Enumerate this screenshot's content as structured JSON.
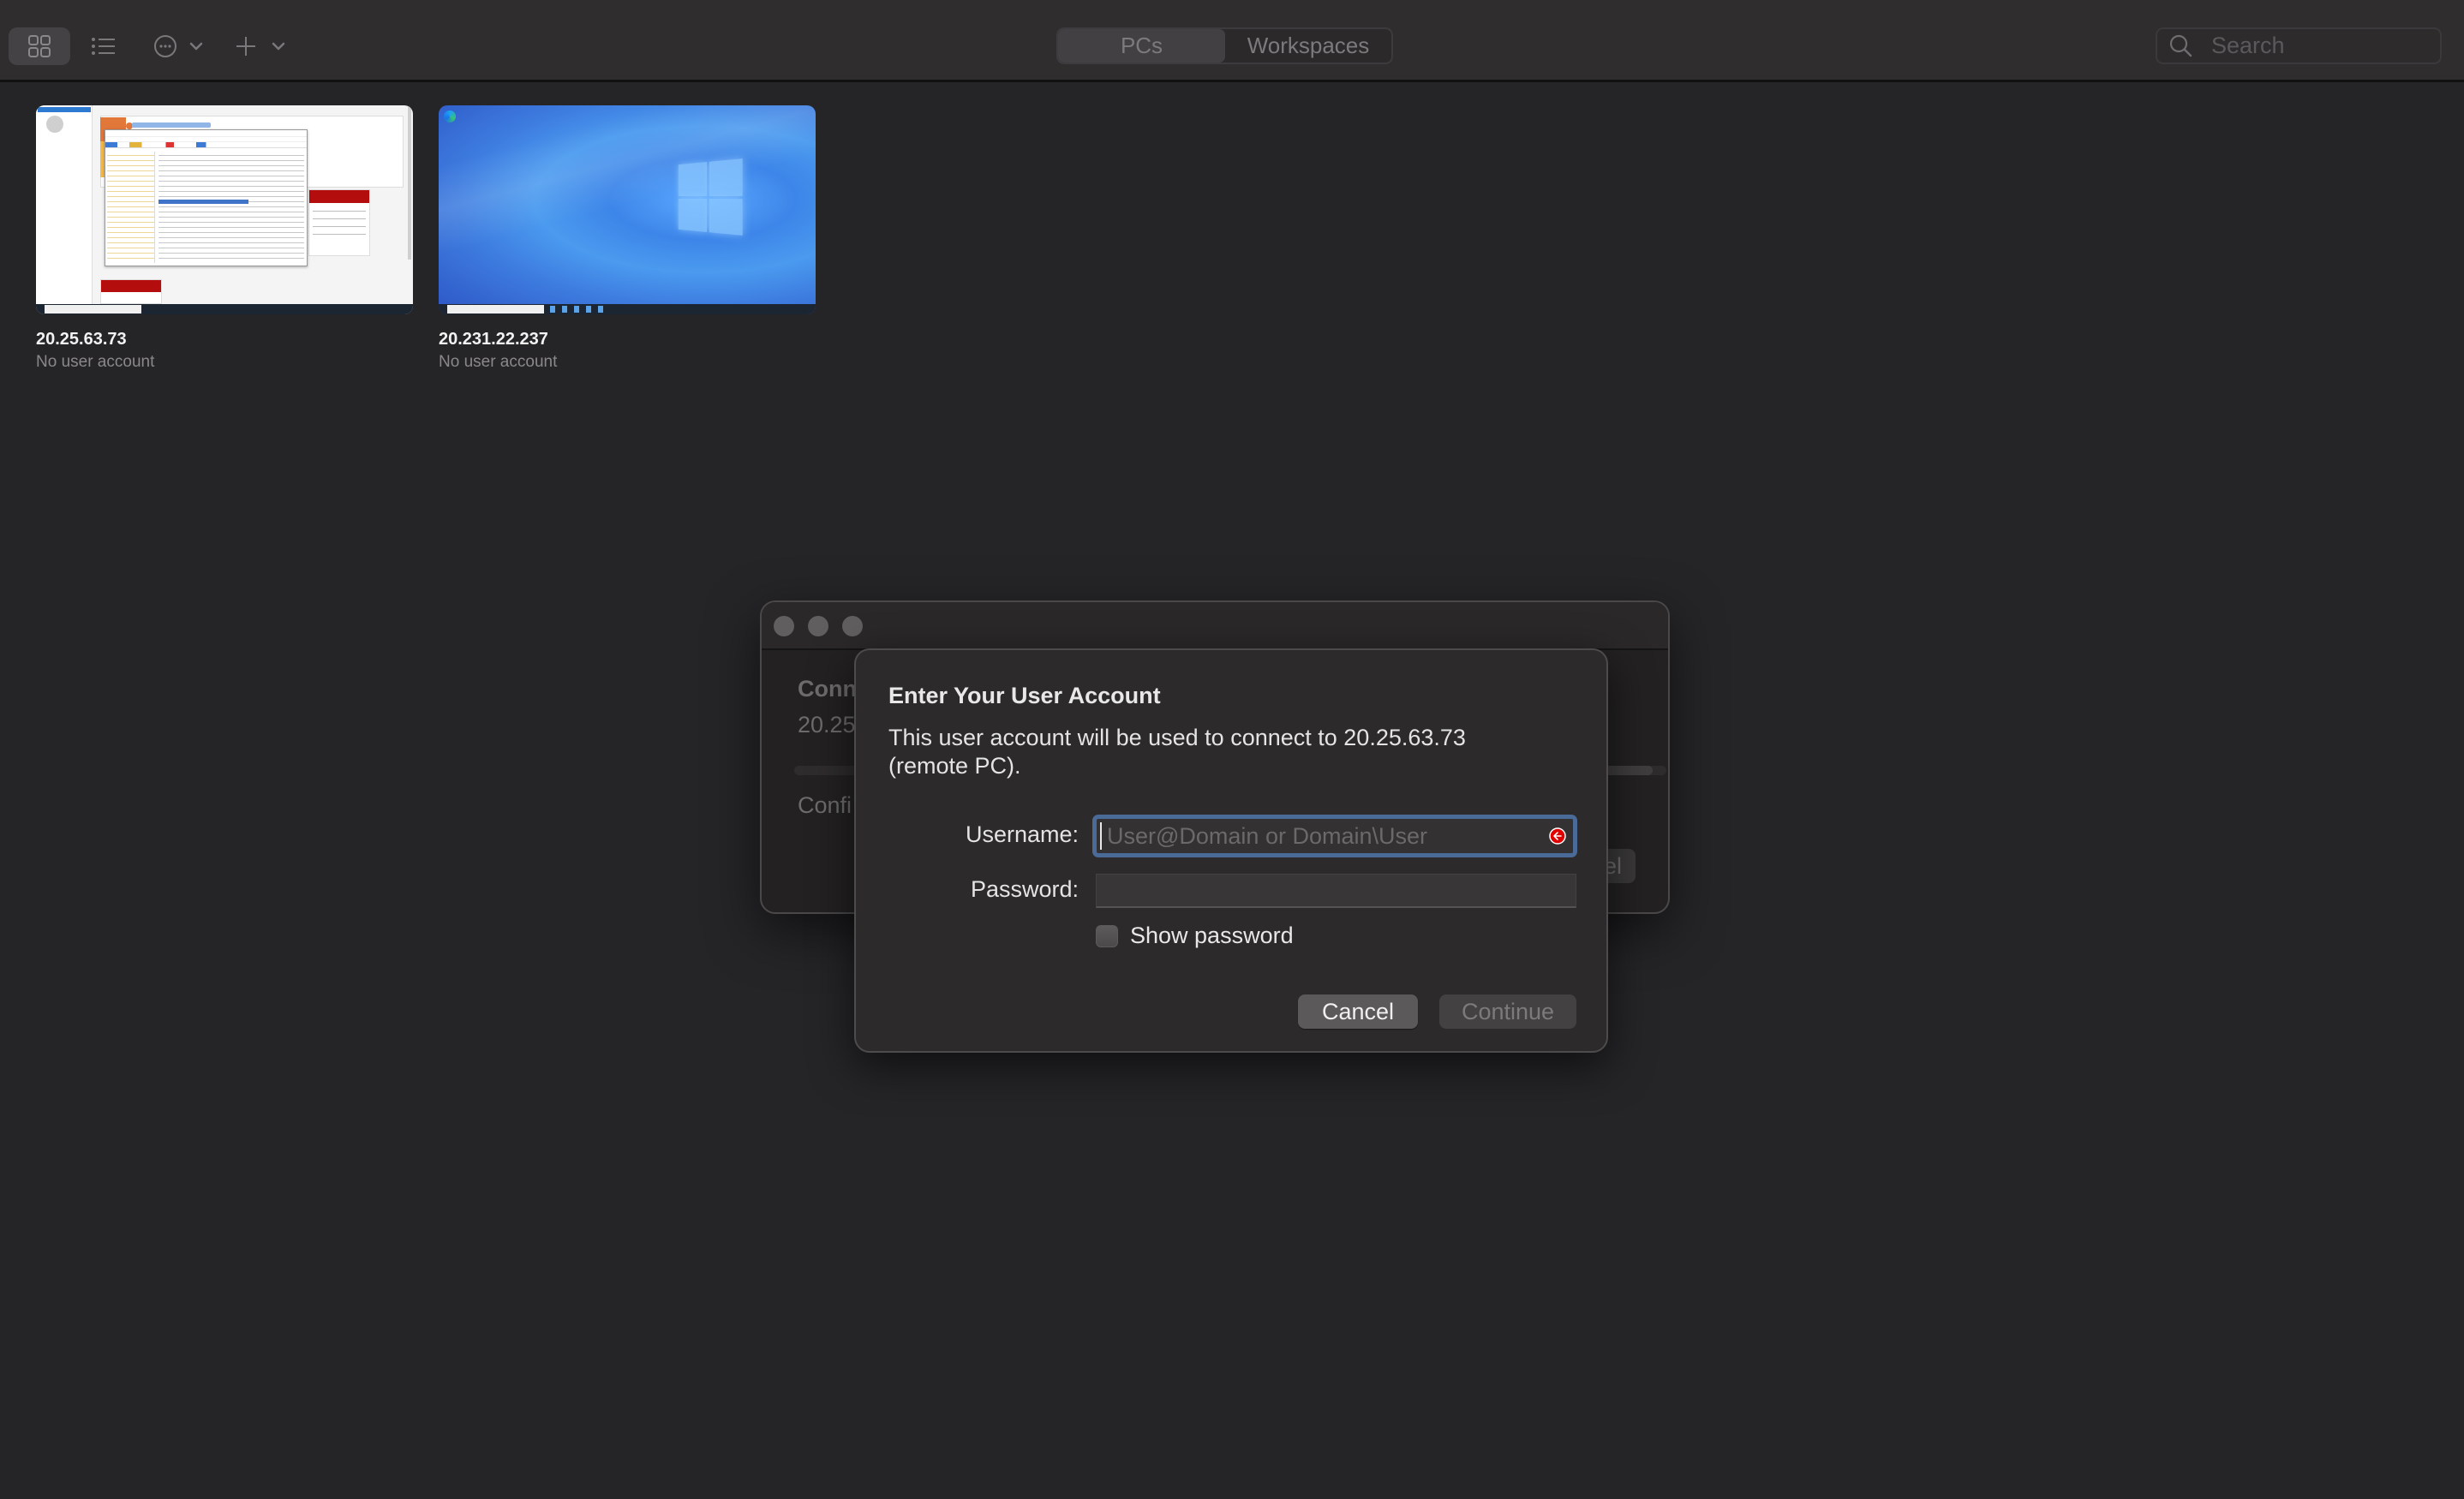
{
  "toolbar": {
    "view_grid_icon": "grid-view-icon",
    "view_list_icon": "list-view-icon",
    "more_icon": "ellipsis-circle-icon",
    "add_icon": "plus-icon",
    "segments": [
      {
        "label": "PCs",
        "selected": true
      },
      {
        "label": "Workspaces",
        "selected": false
      }
    ],
    "search": {
      "placeholder": "Search",
      "value": ""
    }
  },
  "pcs": [
    {
      "name": "20.25.63.73",
      "subtitle": "No user account",
      "thumbnail": "Windows Server Manager with Active Directory Users and Computers"
    },
    {
      "name": "20.231.22.237",
      "subtitle": "No user account",
      "thumbnail": "Windows 10 desktop"
    }
  ],
  "background_window": {
    "heading_visible": "Conn",
    "host_visible": "20.25",
    "status_visible": "Confi",
    "cancel_visible": "cel",
    "traffic_lights": [
      "close",
      "minimize",
      "zoom"
    ]
  },
  "sheet": {
    "title": "Enter Your User Account",
    "body": "This user account will be used to connect to 20.25.63.73 (remote PC).",
    "username_label": "Username:",
    "username_placeholder": "User@Domain or Domain\\User",
    "username_value": "",
    "password_label": "Password:",
    "password_value": "",
    "show_password_label": "Show password",
    "show_password_checked": false,
    "cancel_label": "Cancel",
    "continue_label": "Continue",
    "continue_enabled": false
  },
  "colors": {
    "focus_ring": "#4a6a98",
    "error_indicator": "#e00000",
    "window_bg": "#252427",
    "toolbar_bg": "#2f2d2e"
  }
}
